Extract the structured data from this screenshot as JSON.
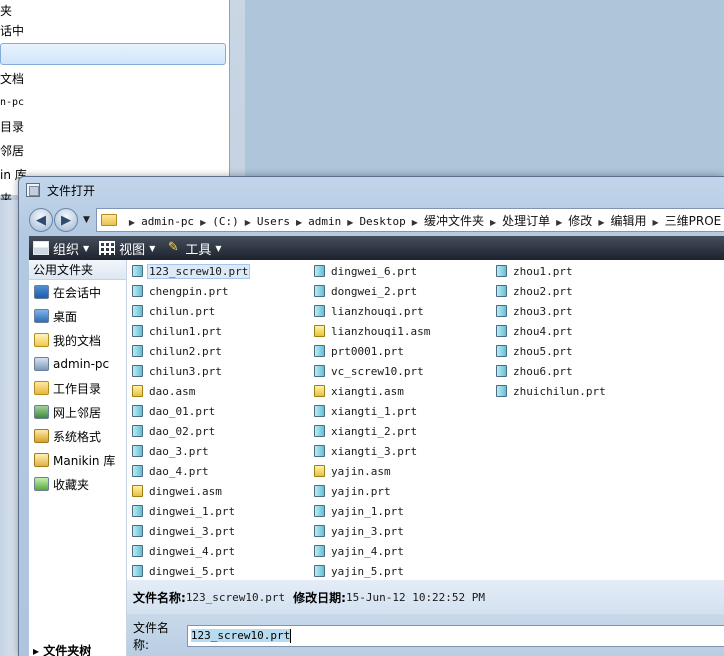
{
  "background_window": {
    "items": [
      "夹",
      "话中",
      "",
      "文档",
      "n-pc",
      "目录",
      "邻居",
      "in 库",
      "夹"
    ]
  },
  "dialog": {
    "title": "文件打开",
    "nav": {
      "back": "◀",
      "forward": "▶",
      "breadcrumb": [
        {
          "text": "admin-pc",
          "cn": false
        },
        {
          "text": "(C:)",
          "cn": false
        },
        {
          "text": "Users",
          "cn": false
        },
        {
          "text": "admin",
          "cn": false
        },
        {
          "text": "Desktop",
          "cn": false
        },
        {
          "text": "缓冲文件夹",
          "cn": true
        },
        {
          "text": "处理订单",
          "cn": true
        },
        {
          "text": "修改",
          "cn": true
        },
        {
          "text": "编辑用",
          "cn": true
        },
        {
          "text": "三维PROE",
          "cn": true
        }
      ]
    },
    "toolbar": {
      "organize": "组织",
      "view": "视图",
      "tools": "工具"
    },
    "sidebar": {
      "header": "公用文件夹",
      "items": [
        {
          "label": "在会话中",
          "icon": "monitor-icon"
        },
        {
          "label": "桌面",
          "icon": "desktop-icon"
        },
        {
          "label": "我的文档",
          "icon": "documents-icon"
        },
        {
          "label": "admin-pc",
          "icon": "computer-icon"
        },
        {
          "label": "工作目录",
          "icon": "working-directory-icon"
        },
        {
          "label": "网上邻居",
          "icon": "network-icon"
        },
        {
          "label": "系统格式",
          "icon": "system-format-icon"
        },
        {
          "label": "Manikin 库",
          "icon": "manikin-library-icon"
        },
        {
          "label": "收藏夹",
          "icon": "favorites-icon"
        }
      ],
      "footer": "文件夹树"
    },
    "files": {
      "columns": [
        [
          "123_screw10.prt",
          "chengpin.prt",
          "chilun.prt",
          "chilun1.prt",
          "chilun2.prt",
          "chilun3.prt",
          "dao.asm",
          "dao_01.prt",
          "dao_02.prt",
          "dao_3.prt",
          "dao_4.prt",
          "dingwei.asm",
          "dingwei_1.prt",
          "dingwei_3.prt",
          "dingwei_4.prt",
          "dingwei_5.prt"
        ],
        [
          "dingwei_6.prt",
          "dongwei_2.prt",
          "lianzhouqi.prt",
          "lianzhouqi1.asm",
          "prt0001.prt",
          "vc_screw10.prt",
          "xiangti.asm",
          "xiangti_1.prt",
          "xiangti_2.prt",
          "xiangti_3.prt",
          "yajin.asm",
          "yajin.prt",
          "yajin_1.prt",
          "yajin_3.prt",
          "yajin_4.prt",
          "yajin_5.prt"
        ],
        [
          "zhou1.prt",
          "zhou2.prt",
          "zhou3.prt",
          "zhou4.prt",
          "zhou5.prt",
          "zhou6.prt",
          "zhuichilun.prt"
        ]
      ],
      "selected": "123_screw10.prt"
    },
    "details": {
      "name_label": "文件名称:",
      "name_value": "123_screw10.prt",
      "date_label": "修改日期:",
      "date_value": "15-Jun-12 10:22:52 PM"
    },
    "filename": {
      "label": "文件名称:",
      "value": "123_screw10.prt"
    }
  }
}
